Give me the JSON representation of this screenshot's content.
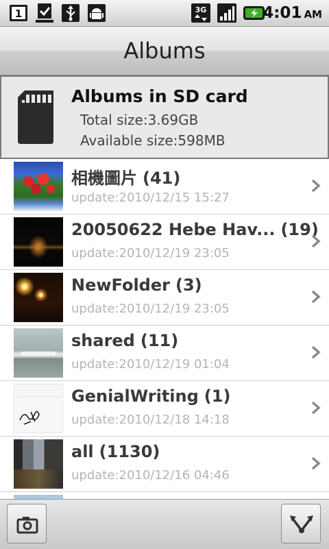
{
  "status_bar": {
    "time": "4:01",
    "ampm": "AM",
    "notification_badge": "1",
    "network_label": "3G"
  },
  "header": {
    "title": "Albums"
  },
  "storage": {
    "title": "Albums in SD card",
    "total_size": "Total size:3.69GB",
    "available_size": "Available size:598MB"
  },
  "albums": [
    {
      "name": "相機圖片",
      "count": "(41)",
      "updated": "update:2010/12/15 15:27"
    },
    {
      "name": "20050622 Hebe Hav...",
      "count": "(19)",
      "updated": "update:2010/12/19 23:05"
    },
    {
      "name": "NewFolder",
      "count": "(3)",
      "updated": "update:2010/12/19 23:05"
    },
    {
      "name": "shared",
      "count": "(11)",
      "updated": "update:2010/12/19 01:04"
    },
    {
      "name": "GenialWriting",
      "count": "(1)",
      "updated": "update:2010/12/18 14:18"
    },
    {
      "name": "all",
      "count": "(1130)",
      "updated": "update:2010/12/16 04:46"
    }
  ],
  "colors": {
    "date_text": "#b5b5b5",
    "album_name": "#3a3a3a",
    "battery_green": "#3fae2a"
  }
}
